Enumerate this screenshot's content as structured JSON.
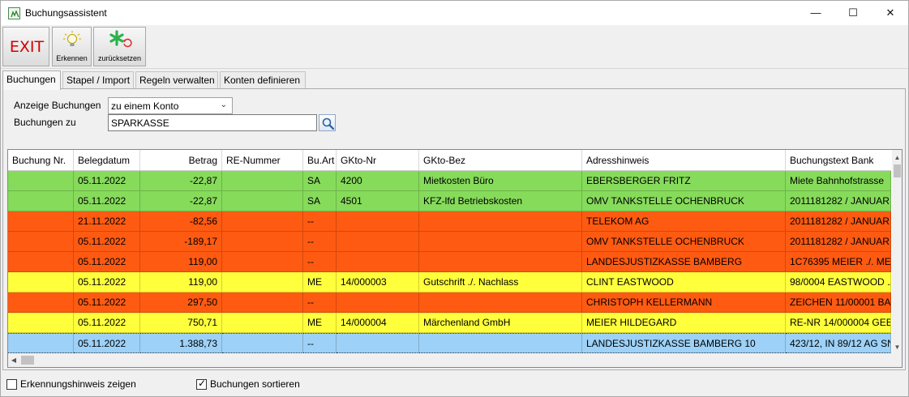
{
  "window": {
    "title": "Buchungsassistent",
    "controls": {
      "minimize": "—",
      "maximize": "☐",
      "close": "✕"
    }
  },
  "toolbar": {
    "exit_label": "EXIT",
    "erkennen_label": "Erkennen",
    "reset_label": "zurücksetzen",
    "icons": {
      "erkennen": "lightbulb-icon",
      "reset": "star-reset-icon"
    }
  },
  "tabs": [
    {
      "label": "Buchungen",
      "active": true
    },
    {
      "label": "Stapel / Import",
      "active": false
    },
    {
      "label": "Regeln verwalten",
      "active": false
    },
    {
      "label": "Konten definieren",
      "active": false
    }
  ],
  "filter": {
    "anzeige_label": "Anzeige Buchungen",
    "anzeige_value": "zu einem Konto",
    "buchungen_zu_label": "Buchungen zu",
    "buchungen_zu_value": "SPARKASSE"
  },
  "grid": {
    "columns": [
      "Buchung Nr.",
      "Belegdatum",
      "Betrag",
      "RE-Nummer",
      "Bu.Art",
      "GKto-Nr",
      "GKto-Bez",
      "Adresshinweis",
      "Buchungstext Bank"
    ],
    "colors": {
      "green": "#86db5b",
      "red": "#ff5a12",
      "yellow": "#ffff3c",
      "selected": "#9dd1f7"
    },
    "rows": [
      {
        "nr": "",
        "datum": "05.11.2022",
        "betrag": "-22,87",
        "re": "",
        "art": "SA",
        "gkto_nr": "4200",
        "gkto_bez": "Mietkosten Büro",
        "adresse": "EBERSBERGER FRITZ",
        "text": "Miete Bahnhofstrasse",
        "status": "green"
      },
      {
        "nr": "",
        "datum": "05.11.2022",
        "betrag": "-22,87",
        "re": "",
        "art": "SA",
        "gkto_nr": "4501",
        "gkto_bez": "KFZ-lfd Betriebskosten",
        "adresse": "OMV TANKSTELLE OCHENBRUCK",
        "text": "2011181282 / JANUAR",
        "status": "green"
      },
      {
        "nr": "",
        "datum": "21.11.2022",
        "betrag": "-82,56",
        "re": "",
        "art": "--",
        "gkto_nr": "",
        "gkto_bez": "",
        "adresse": "TELEKOM AG",
        "text": "2011181282 / JANUAR",
        "status": "red"
      },
      {
        "nr": "",
        "datum": "05.11.2022",
        "betrag": "-189,17",
        "re": "",
        "art": "--",
        "gkto_nr": "",
        "gkto_bez": "",
        "adresse": "OMV TANKSTELLE OCHENBRUCK",
        "text": "2011181282 / JANUAR",
        "status": "red"
      },
      {
        "nr": "",
        "datum": "05.11.2022",
        "betrag": "119,00",
        "re": "",
        "art": "--",
        "gkto_nr": "",
        "gkto_bez": "",
        "adresse": "LANDESJUSTIZKASSE BAMBERG",
        "text": "1C76395 MEIER ./. ME",
        "status": "red"
      },
      {
        "nr": "",
        "datum": "05.11.2022",
        "betrag": "119,00",
        "re": "",
        "art": "ME",
        "gkto_nr": "14/000003",
        "gkto_bez": "Gutschrift ./. Nachlass",
        "adresse": "CLINT EASTWOOD",
        "text": "98/0004 EASTWOOD ./.",
        "status": "yellow"
      },
      {
        "nr": "",
        "datum": "05.11.2022",
        "betrag": "297,50",
        "re": "",
        "art": "--",
        "gkto_nr": "",
        "gkto_bez": "",
        "adresse": "CHRISTOPH KELLERMANN",
        "text": "ZEICHEN 11/00001 BA",
        "status": "red"
      },
      {
        "nr": "",
        "datum": "05.11.2022",
        "betrag": "750,71",
        "re": "",
        "art": "ME",
        "gkto_nr": "14/000004",
        "gkto_bez": "Märchenland GmbH",
        "adresse": "MEIER HILDEGARD",
        "text": "RE-NR 14/000004 GEB",
        "status": "yellow"
      },
      {
        "nr": "",
        "datum": "05.11.2022",
        "betrag": "1.388,73",
        "re": "",
        "art": "--",
        "gkto_nr": "",
        "gkto_bez": "",
        "adresse": "LANDESJUSTIZKASSE BAMBERG 10",
        "text": "423/12, IN 89/12 AG SN",
        "status": "selected"
      }
    ]
  },
  "options": {
    "hint_label": "Erkennungshinweis zeigen",
    "hint_checked": false,
    "sort_label": "Buchungen sortieren",
    "sort_checked": true
  }
}
